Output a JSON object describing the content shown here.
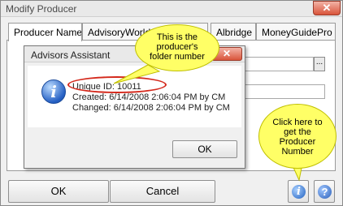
{
  "window": {
    "title": "Modify Producer",
    "close_glyph": "✕"
  },
  "tabs": [
    {
      "label": "Producer Name"
    },
    {
      "label": "AdvisoryWorld"
    },
    {
      "label": "Albridge"
    },
    {
      "label": "MoneyGuidePro"
    }
  ],
  "form": {
    "browse_label": "..."
  },
  "dialog": {
    "title": "Advisors Assistant",
    "close_glyph": "✕",
    "icon_glyph": "i",
    "line1": "Unique ID: 10011",
    "line2": "Created: 6/14/2008 2:06:04 PM by CM",
    "line3": "Changed: 6/14/2008 2:06:04 PM by CM",
    "ok_label": "OK"
  },
  "buttons": {
    "ok_label": "OK",
    "cancel_label": "Cancel",
    "info_glyph": "i",
    "help_glyph": "?"
  },
  "callouts": {
    "folder": [
      "This is the",
      "producer's",
      "folder number"
    ],
    "click": [
      "Click here to",
      "get the",
      "Producer",
      "Number"
    ]
  },
  "colors": {
    "callout_fill": "#ffff66",
    "highlight_oval": "#d4281b",
    "info_blue": "#2560c4"
  }
}
